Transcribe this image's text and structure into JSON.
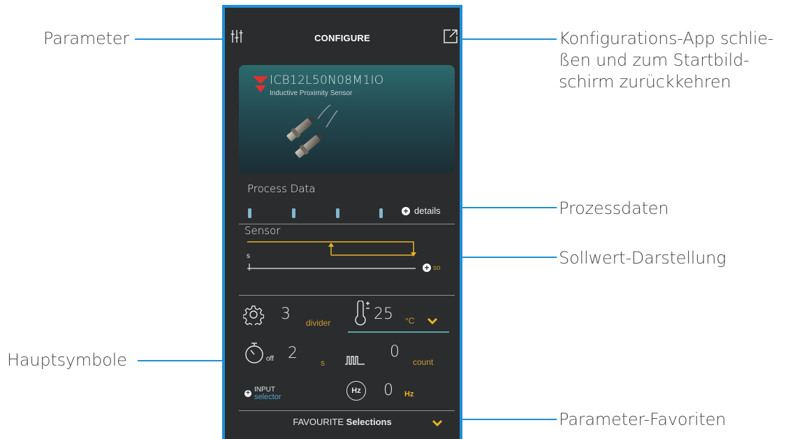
{
  "callouts": {
    "parameter": "Parameter",
    "close_app": [
      "Konfigurations-App schlie-",
      "ßen und zum Startbild-",
      "schirm zurückkehren"
    ],
    "process_data": "Prozessdaten",
    "setpoint": "Sollwert-Darstellung",
    "main_icons": "Hauptsymbole",
    "favourites": "Parameter-Favoriten"
  },
  "header": {
    "title": "CONFIGURE"
  },
  "device": {
    "model": "ICB12L50N08M1IO",
    "type": "Inductive Proximity Sensor"
  },
  "process_data": {
    "label": "Process Data",
    "details": "details"
  },
  "sensor": {
    "label": "Sensor",
    "s_label": "s",
    "so_label": "so"
  },
  "parameters": {
    "divider": {
      "value": "3",
      "unit": "divider"
    },
    "temperature": {
      "value": "25",
      "unit": "°C"
    },
    "timer": {
      "suffix": "off",
      "value": "2",
      "unit": "s"
    },
    "counter": {
      "value": "0",
      "unit": "count"
    },
    "input": {
      "line1": "INPUT",
      "line2": "selector"
    },
    "frequency": {
      "icon_text": "Hz",
      "value": "0",
      "unit": "Hz"
    }
  },
  "favourites": {
    "prefix": "FAVOURITE",
    "bold": "Selections"
  },
  "colors": {
    "accent_blue": "#1f8ed6",
    "accent_yellow": "#e8b423",
    "brand_red": "#e03030"
  }
}
